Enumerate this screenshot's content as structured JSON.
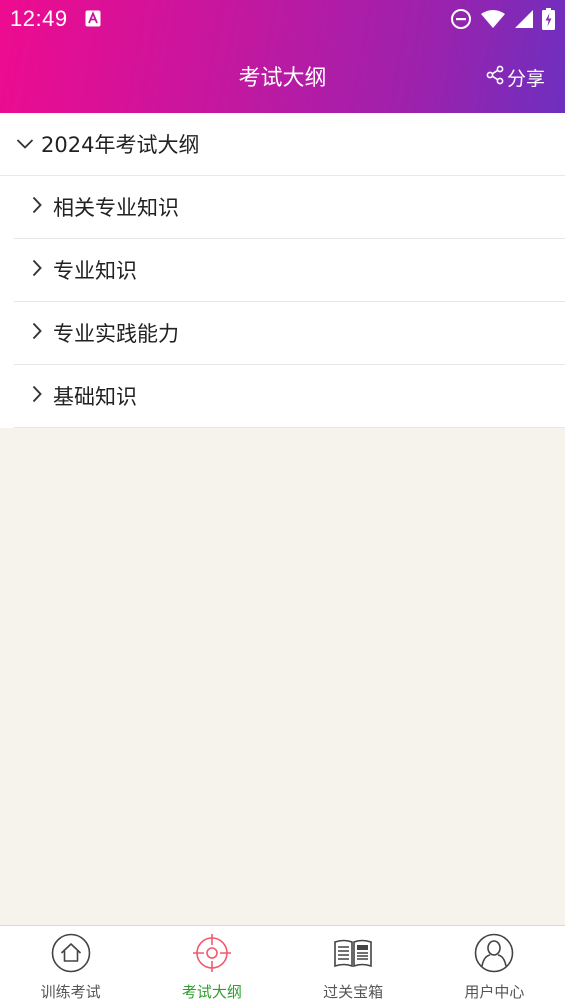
{
  "status_bar": {
    "time": "12:49"
  },
  "header": {
    "title": "考试大纲",
    "share_label": "分享"
  },
  "outline": {
    "group_title": "2024年考试大纲",
    "items": [
      {
        "label": "相关专业知识"
      },
      {
        "label": "专业知识"
      },
      {
        "label": "专业实践能力"
      },
      {
        "label": "基础知识"
      }
    ]
  },
  "tabs": [
    {
      "label": "训练考试",
      "icon": "home-icon",
      "active": false
    },
    {
      "label": "考试大纲",
      "icon": "target-icon",
      "active": true
    },
    {
      "label": "过关宝箱",
      "icon": "book-icon",
      "active": false
    },
    {
      "label": "用户中心",
      "icon": "user-icon",
      "active": false
    }
  ],
  "colors": {
    "header_gradient_start": "#ee0b8f",
    "header_gradient_end": "#6e2fbf",
    "active_tab_label": "#2e9e2e",
    "active_tab_icon": "#f05a6e",
    "page_background": "#f6f2ec"
  }
}
